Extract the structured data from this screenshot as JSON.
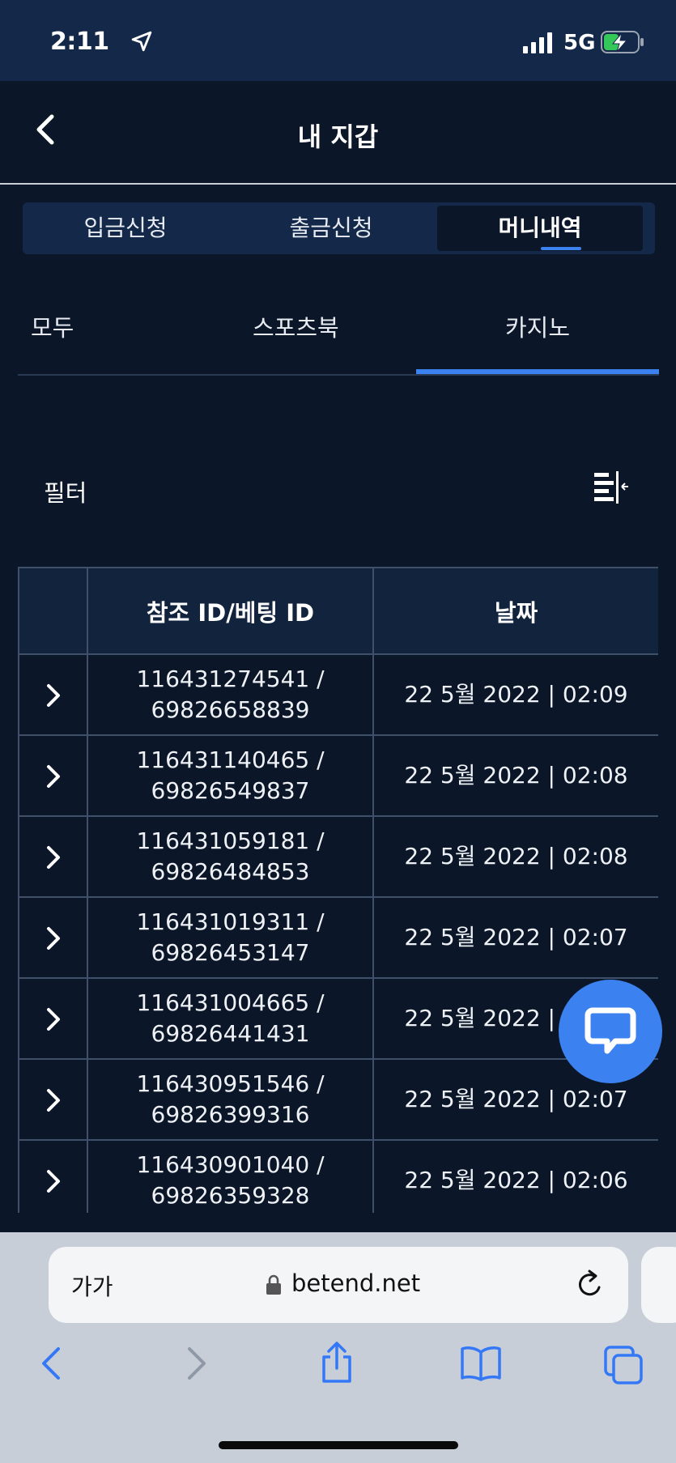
{
  "status_bar": {
    "time": "2:11",
    "network": "5G"
  },
  "header": {
    "title": "내 지갑"
  },
  "segment_tabs": [
    {
      "label": "입금신청",
      "active": false
    },
    {
      "label": "출금신청",
      "active": false
    },
    {
      "label": "머니내역",
      "active": true
    }
  ],
  "sub_tabs": [
    {
      "label": "모두",
      "active": false
    },
    {
      "label": "스포츠북",
      "active": false
    },
    {
      "label": "카지노",
      "active": true
    }
  ],
  "filter": {
    "label": "필터"
  },
  "table": {
    "headers": [
      "",
      "참조 ID/베팅 ID",
      "날짜"
    ],
    "rows": [
      {
        "ref_id": "116431274541 /",
        "bet_id": "69826658839",
        "date": "22 5월 2022 | 02:09"
      },
      {
        "ref_id": "116431140465 /",
        "bet_id": "69826549837",
        "date": "22 5월 2022 | 02:08"
      },
      {
        "ref_id": "116431059181 /",
        "bet_id": "69826484853",
        "date": "22 5월 2022 | 02:08"
      },
      {
        "ref_id": "116431019311 /",
        "bet_id": "69826453147",
        "date": "22 5월 2022 | 02:07"
      },
      {
        "ref_id": "116431004665 /",
        "bet_id": "69826441431",
        "date": "22 5월 2022 | 02:07"
      },
      {
        "ref_id": "116430951546 /",
        "bet_id": "69826399316",
        "date": "22 5월 2022 | 02:07"
      },
      {
        "ref_id": "116430901040 /",
        "bet_id": "69826359328",
        "date": "22 5월 2022 | 02:06"
      }
    ]
  },
  "browser": {
    "aa_label": "가가",
    "url": "betend.net"
  },
  "colors": {
    "background": "#0b1628",
    "accent": "#3b82f0",
    "header_bar": "#14294a"
  }
}
